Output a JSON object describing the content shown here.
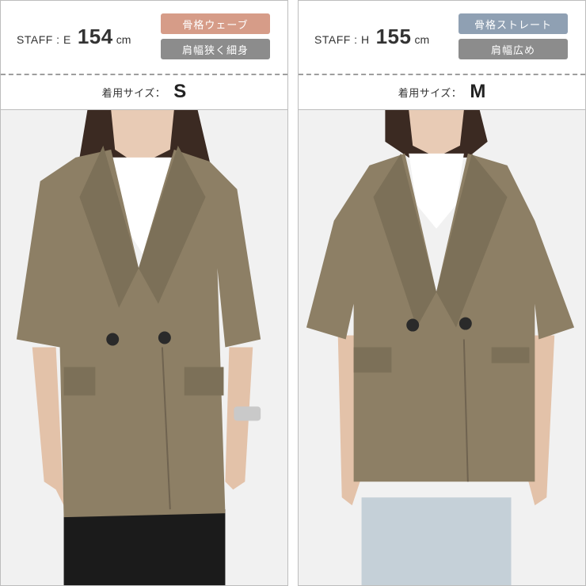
{
  "panels": [
    {
      "staff_label": "STAFF : E",
      "height_value": "154",
      "height_unit": "cm",
      "tags": [
        {
          "text": "骨格ウェーブ",
          "color": "#d69c88"
        },
        {
          "text": "肩幅狭く細身",
          "color": "#8c8c8c"
        }
      ],
      "size_label": "着用サイズ：",
      "size_value": "S"
    },
    {
      "staff_label": "STAFF : H",
      "height_value": "155",
      "height_unit": "cm",
      "tags": [
        {
          "text": "骨格ストレート",
          "color": "#8fa0b3"
        },
        {
          "text": "肩幅広め",
          "color": "#8c8c8c"
        }
      ],
      "size_label": "着用サイズ：",
      "size_value": "M"
    }
  ],
  "colors": {
    "jacket": "#8d7f65",
    "jacket_shadow": "#6f6350",
    "background": "#f1f1f1"
  }
}
